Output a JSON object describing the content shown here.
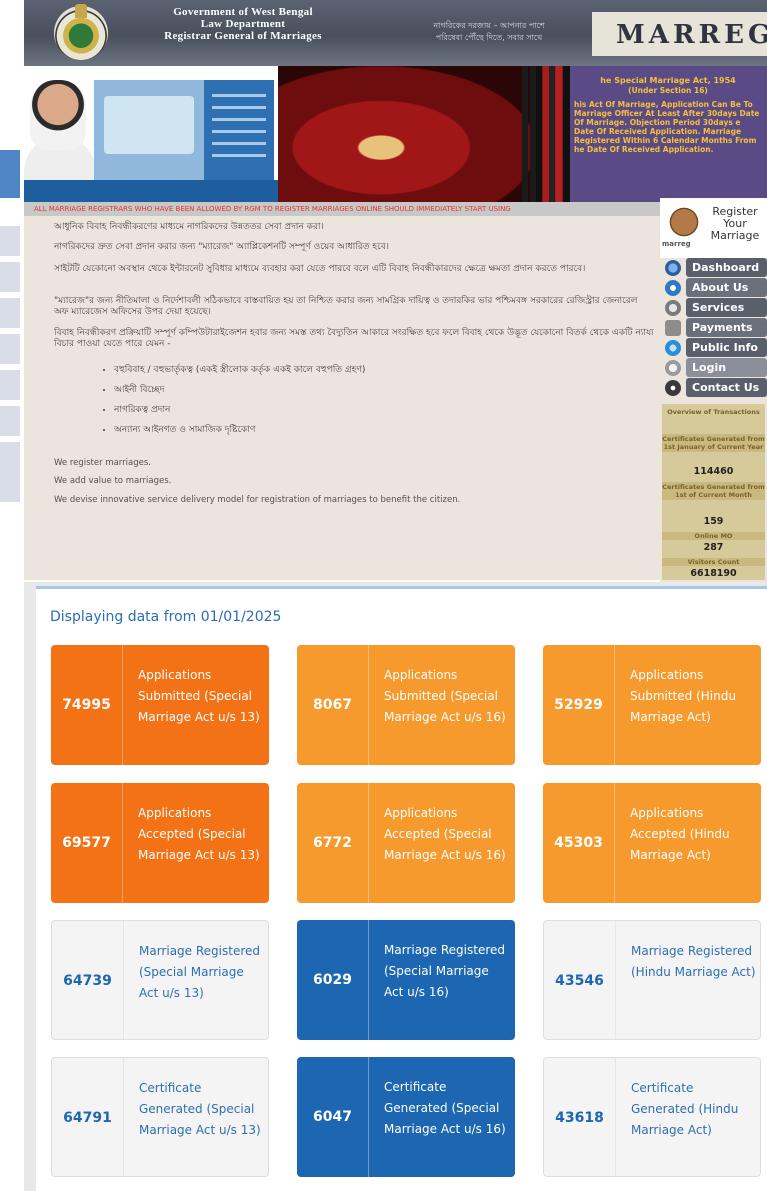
{
  "header": {
    "gov_lines": [
      "Government of West Bengal",
      "Law Department",
      "Registrar General of Marriages"
    ],
    "tagline": [
      "নাগরিকের দরজায় – আপনার পাশে",
      "পরিষেবা পৌঁছে দিতে, সবার সাথে"
    ],
    "brand": "MARREG"
  },
  "banner": {
    "act_title": "he Special Marriage Act, 1954",
    "act_section": "(Under Section 16)",
    "act_text": "his Act Of Marriage, Application Can Be To Marriage Officer At Least After 30days Date Of Marriage. Objection Period 30days e Date Of Received Application. Marriage Registered Within 6 Calendar Months From he Date Of Received Application."
  },
  "marquee": "ALL MARRIAGE REGISTRARS WHO HAVE BEEN ALLOWED BY RGM TO REGISTER MARRIAGES ONLINE SHOULD IMMEDIATELY START USING",
  "content": {
    "p0": "আধুনিক বিবাহ নিবন্ধীকরণের মাধ্যমে নাগরিকদের উন্নততর সেবা প্রদান করা।",
    "p1": "নাগরিকদের দ্রুত সেবা প্রদান করার জন্য \"ম্যারেজ\" অ্যাপ্লিকেশনটি সম্পূর্ণ ওয়েব আধারিত হবে।",
    "p2": "সাইটটি যেকোনো অবস্থান থেকে ইন্টারনেট সুবিধার মাধ্যমে ব্যবহার করা যেতে পারবে বলে এটি বিবাহ নিবন্ধীকারদের ক্ষেত্রে ক্ষমতা প্রদান করতে পারবে।",
    "p3": "\"ম্যারেজ\"র জন্য নীতিমালা ও নির্দেশাবলী সঠিকভাবে বাস্তবায়িত হয় তা নিশ্চিত করার জন্য সামগ্রিক দায়িত্ব ও তদারকির ভার পশ্চিমবঙ্গ সরকারের রেজিস্ট্রার জেনারেল অফ ম্যারেজেস অফিসের উপর দেয়া হয়েছে।",
    "p4": "বিবাহ নিবন্ধীকরণ প্রক্রিয়াটি সম্পূর্ণ কম্পিউটারাইজেশন হবার জন্য সমস্ত তথ্য বৈদ্যুতিন আকারে সংরক্ষিত হবে ফলে বিবাহ থেকে উদ্ভূত যেকোনো বিতর্ক থেকে একটি ন্যায্য বিচার পাওয়া যেতে পারে যেমন -",
    "bullets": [
      "বহুবিবাহ / বহুভার্তৃকত্ব (একই স্ত্রীলোক কর্তৃক একই কালে বহুপতি গ্রহণ)",
      "আইনী বিচ্ছেদ",
      "নাগরিকত্ব প্রদান",
      "অন্যান্য আইনগত ও সামাজিক দৃষ্টিকোণ"
    ],
    "en1": "We register marriages.",
    "en2": "We add value to marriages.",
    "en3": "We devise innovative service delivery model for registration of marriages to benefit the citizen."
  },
  "sidebar": {
    "register": "Register Your Marriage",
    "logo": "marreg",
    "nav": [
      {
        "label": "Dashboard",
        "icon": "dashboard-icon"
      },
      {
        "label": "About Us",
        "icon": "info-icon"
      },
      {
        "label": "Services",
        "icon": "services-icon"
      },
      {
        "label": "Payments",
        "icon": "payments-icon"
      },
      {
        "label": "Public Info",
        "icon": "globe-icon"
      },
      {
        "label": "Login",
        "icon": "login-icon"
      },
      {
        "label": "Contact Us",
        "icon": "phone-icon"
      }
    ],
    "stats": {
      "overview": "Overview of Transactions",
      "cert_year_label": "Certificates Generated from 1st January of Current Year",
      "cert_year_value": "114460",
      "cert_month_label": "Certificates Generated from 1st of Current Month",
      "cert_month_value": "159",
      "online_mo_label": "Online MO",
      "online_mo_value": "287",
      "visitors_label": "Visitors Count",
      "visitors_value": "6618190"
    }
  },
  "dashboard": {
    "heading": "Displaying data from 01/01/2025",
    "cards": [
      {
        "value": "74995",
        "label": "Applications Submitted (Special Marriage Act u/s 13)"
      },
      {
        "value": "8067",
        "label": "Applications Submitted (Special Marriage Act u/s 16)"
      },
      {
        "value": "52929",
        "label": "Applications Submitted (Hindu Marriage Act)"
      },
      {
        "value": "69577",
        "label": "Applications Accepted (Special Marriage Act u/s 13)"
      },
      {
        "value": "6772",
        "label": "Applications Accepted (Special Marriage Act u/s 16)"
      },
      {
        "value": "45303",
        "label": "Applications Accepted (Hindu Marriage Act)"
      },
      {
        "value": "64739",
        "label": "Marriage Registered (Special Marriage Act u/s 13)"
      },
      {
        "value": "6029",
        "label": "Marriage Registered (Special Marriage Act u/s 16)"
      },
      {
        "value": "43546",
        "label": "Marriage Registered (Hindu Marriage Act)"
      },
      {
        "value": "64791",
        "label": "Certificate Generated (Special Marriage Act u/s 13)"
      },
      {
        "value": "6047",
        "label": "Certificate Generated (Special Marriage Act u/s 16)"
      },
      {
        "value": "43618",
        "label": "Certificate Generated (Hindu Marriage Act)"
      }
    ]
  },
  "colors": {
    "accent_red": "#f47216",
    "accent_orange": "#f79a2e",
    "accent_blue": "#1d67b2",
    "heading_blue": "#2c6db3"
  }
}
